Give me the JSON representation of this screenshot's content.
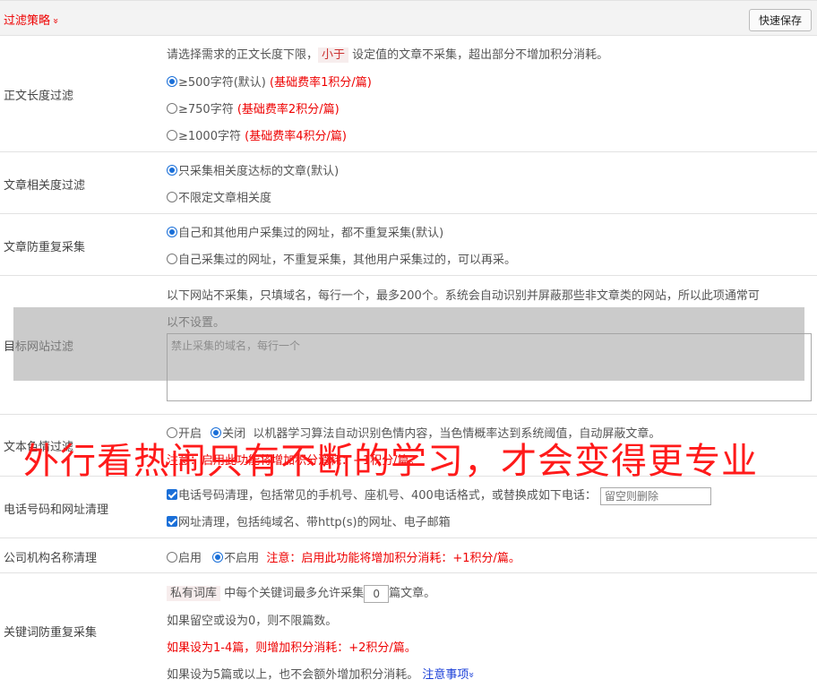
{
  "header": {
    "title": "过滤策略",
    "chevron": "»",
    "save_label": "快速保存"
  },
  "length_filter": {
    "label": "正文长度过滤",
    "desc_pre": "请选择需求的正文长度下限，",
    "desc_tag": "小于",
    "desc_post": "设定值的文章不采集，超出部分不增加积分消耗。",
    "options": [
      {
        "text": "≥500字符(默认)",
        "note": "(基础费率1积分/篇)",
        "selected": true
      },
      {
        "text": "≥750字符",
        "note": "(基础费率2积分/篇)",
        "selected": false
      },
      {
        "text": "≥1000字符",
        "note": "(基础费率4积分/篇)",
        "selected": false
      }
    ]
  },
  "relevance_filter": {
    "label": "文章相关度过滤",
    "options": [
      "只采集相关度达标的文章(默认)",
      "不限定文章相关度"
    ]
  },
  "duplicate_filter": {
    "label": "文章防重复采集",
    "options": [
      "自己和其他用户采集过的网址，都不重复采集(默认)",
      "自己采集过的网址，不重复采集，其他用户采集过的，可以再采。"
    ]
  },
  "site_filter": {
    "label": "目标网站过滤",
    "desc_line1": "以下网站不采集，只填域名，每行一个，最多200个。系统会自动识别并屏蔽那些非文章类的网站，所以此项通常可",
    "desc_line2": "以不设置。",
    "placeholder": "禁止采集的域名，每行一个"
  },
  "text_filter": {
    "label": "文本色情过滤",
    "on": "开启",
    "off": "关闭",
    "desc": "以机器学习算法自动识别色情内容，当色情概率达到系统阈值，自动屏蔽文章。",
    "note": "注意：启用此功能将增加积分消耗：+1积分/篇。"
  },
  "phone_clean": {
    "label": "电话号码和网址清理",
    "phone_text": "电话号码清理，包括常见的手机号、座机号、400电话格式，或替换成如下电话：",
    "phone_placeholder": "留空则删除",
    "url_text": "网址清理，包括纯域名、带http(s)的网址、电子邮箱"
  },
  "org_clean": {
    "label": "公司机构名称清理",
    "enable": "启用",
    "disable": "不启用",
    "note": "注意：启用此功能将增加积分消耗：+1积分/篇。"
  },
  "keyword_dup": {
    "label": "关键词防重复采集",
    "tag": "私有词库",
    "line1_mid": "中每个关键词最多允许采集",
    "value": "0",
    "line1_post": "篇文章。",
    "line2": "如果留空或设为0，则不限篇数。",
    "line3": "如果设为1-4篇，则增加积分消耗：+2积分/篇。",
    "line4": "如果设为5篇或以上，也不会额外增加积分消耗。",
    "link": "注意事项",
    "link_chev": "»"
  },
  "watermark": "外行看热闹只有不断的学习，才会变得更专业"
}
